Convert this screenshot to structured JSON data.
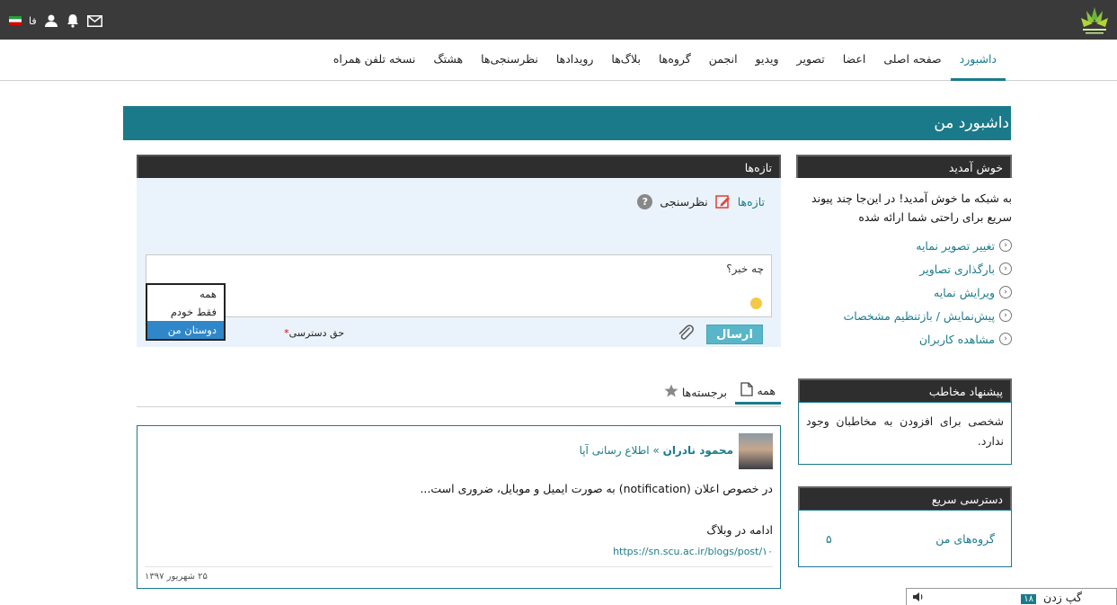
{
  "topbar": {
    "lang": "فا",
    "icons": [
      "flag-iran-icon",
      "user-icon",
      "bell-icon",
      "mail-icon"
    ]
  },
  "nav": {
    "items": [
      "داشبورد",
      "صفحه اصلی",
      "اعضا",
      "تصویر",
      "ویدیو",
      "انجمن",
      "گروه‌ها",
      "بلاگ‌ها",
      "رویدادها",
      "نظرسنجی‌ها",
      "هشتگ",
      "نسخه تلفن همراه"
    ],
    "active_index": 0
  },
  "page": {
    "title": "داشبورد من"
  },
  "welcome": {
    "heading": "خوش آمدید",
    "text": "به شبکه ما خوش آمدید! در این‌جا چند پیوند سریع برای راحتی شما ارائه شده",
    "links": [
      "تغییر تصویر نمایه",
      "بارگذاری تصاویر",
      "ویرایش نمایه",
      "پیش‌نمایش / بازتنظیم مشخصات",
      "مشاهده کاربران"
    ]
  },
  "suggest": {
    "heading": "پیشنهاد مخاطب",
    "text": "شخصی برای افزودن به مخاطبان وجود ندارد."
  },
  "quick": {
    "heading": "دسترسی سریع",
    "label": "گروه‌های من",
    "count": "۵"
  },
  "news": {
    "heading": "تازه‌ها",
    "tab_news": "تازه‌ها",
    "tab_poll": "نظرسنجی",
    "placeholder": "چه خبر؟",
    "send": "ارسال",
    "access_label": "حق دسترسی",
    "access_required": "*",
    "access_options": [
      "همه",
      "فقط خودم",
      "دوستان من"
    ],
    "access_selected_index": 2
  },
  "feed": {
    "tab_all": "همه",
    "tab_featured": "برجسته‌ها"
  },
  "post": {
    "author": "محمود نادران",
    "separator": "»",
    "target": "اطلاع رسانی آپا",
    "summary": "در خصوص اعلان (notification) به صورت ایمیل و موبایل، ضروری است...",
    "more": "ادامه در وبلاگ",
    "url": "https://sn.scu.ac.ir/blogs/post/۱۰",
    "date": "۲۵ شهریور ۱۳۹۷"
  },
  "chat": {
    "label": "گپ زدن",
    "count": "۱۸"
  },
  "colors": {
    "teal": "#1b7a8a",
    "dark": "#3a3a3a",
    "blue_select": "#2f87c9"
  }
}
